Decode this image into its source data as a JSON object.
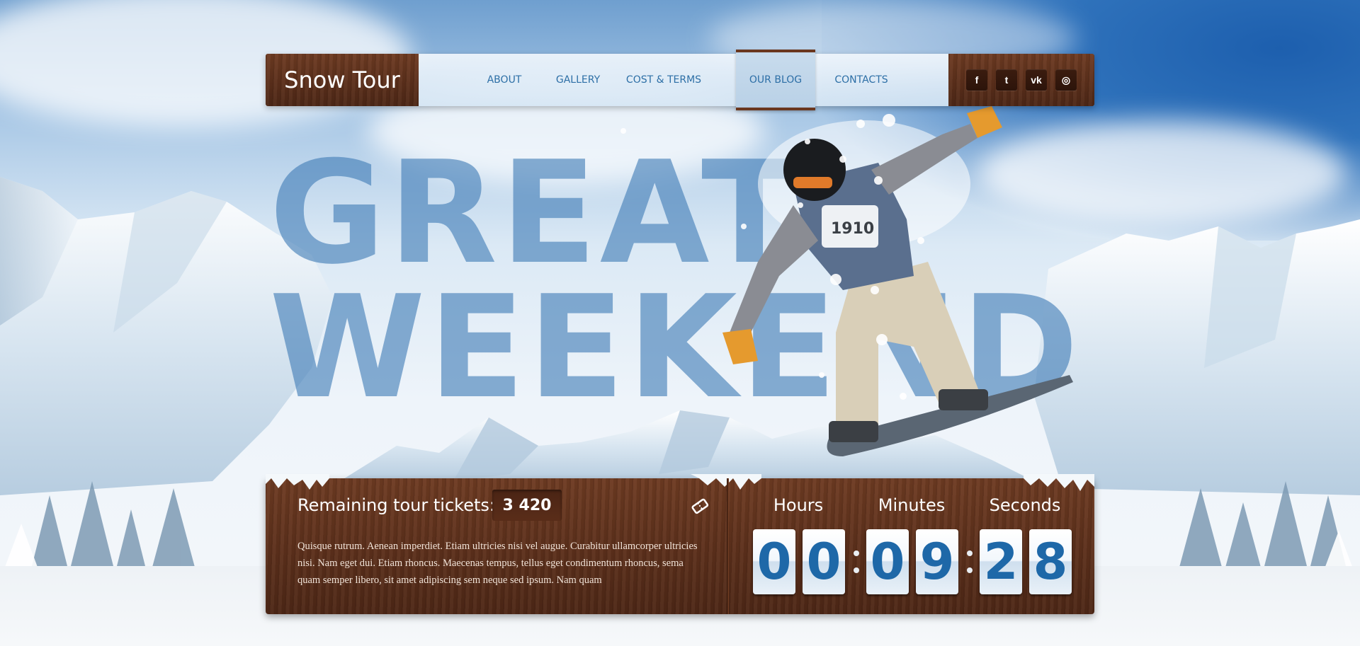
{
  "site": {
    "logo": "Snow Tour"
  },
  "nav": {
    "items": [
      {
        "label": "ABOUT"
      },
      {
        "label": "GALLERY"
      },
      {
        "label": "COST & TERMS"
      },
      {
        "label": "OUR BLOG",
        "active": true
      },
      {
        "label": "CONTACTS"
      }
    ],
    "social": [
      {
        "icon": "facebook-icon",
        "glyph": "f"
      },
      {
        "icon": "twitter-icon",
        "glyph": "t"
      },
      {
        "icon": "vk-icon",
        "glyph": "vk"
      },
      {
        "icon": "dribbble-icon",
        "glyph": "◎"
      }
    ]
  },
  "hero": {
    "line1": "GREAT",
    "line2": "WEEKEND",
    "bib_number": "1910"
  },
  "tickets": {
    "label": "Remaining tour tickets:",
    "count": "3 420",
    "icon": "ticket-icon",
    "description": "Quisque rutrum. Aenean imperdiet. Etiam ultricies nisi vel augue. Curabitur ullamcorper ultricies nisi. Nam eget dui. Etiam rhoncus. Maecenas tempus, tellus eget condimentum rhoncus, sema quam semper libero, sit amet adipiscing sem neque sed ipsum. Nam quam"
  },
  "countdown": {
    "hours_label": "Hours",
    "minutes_label": "Minutes",
    "seconds_label": "Seconds",
    "hours": [
      "0",
      "0"
    ],
    "minutes": [
      "0",
      "9"
    ],
    "seconds": [
      "2",
      "8"
    ]
  },
  "colors": {
    "wood_dark": "#4e2716",
    "wood_light": "#6e3b22",
    "nav_text": "#2d6fa6",
    "digit_text": "#1e68a8",
    "headline": "#407cb6"
  }
}
